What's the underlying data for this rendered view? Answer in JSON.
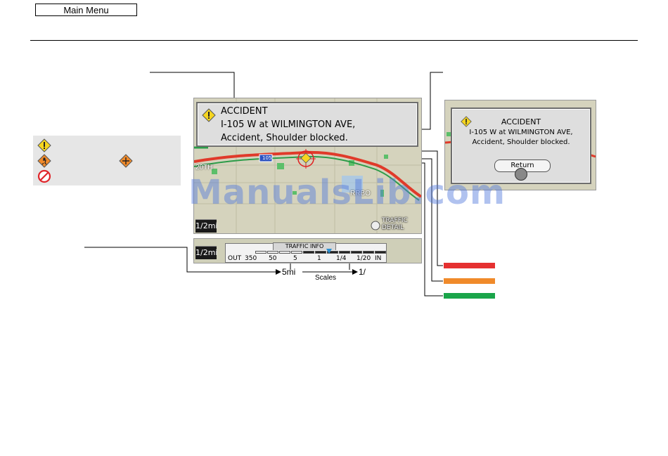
{
  "header": {
    "main_menu_label": "Main Menu"
  },
  "popup": {
    "title": "ACCIDENT",
    "line1": "I-105 W at WILMINGTON AVE,",
    "line2": "Accident, Shoulder blocked."
  },
  "popup_small": {
    "title": "ACCIDENT",
    "line1": "I-105 W at WILMINGTON AVE,",
    "line2": "Accident, Shoulder blocked.",
    "return_label": "Return"
  },
  "map": {
    "scale_badge": "1/2mi",
    "traffic_detail_line1": "TRAFFIC",
    "traffic_detail_line2": "DETAIL",
    "road_shield": "105",
    "label_20th": "20TH",
    "label_rrbo": "RRBO"
  },
  "traffic_info": {
    "scale_badge": "1/2mi",
    "tab_label": "TRAFFIC INFO",
    "out_label": "OUT",
    "ticks": [
      "350",
      "50",
      "5",
      "1",
      "1/4",
      "1/20"
    ],
    "in_label": "IN",
    "segments_on": [
      false,
      false,
      false,
      false,
      true,
      true,
      true,
      true,
      true,
      true,
      true
    ]
  },
  "scales": {
    "left_value": "5mi",
    "right_value": "1/",
    "caption": "Scales"
  },
  "colors": {
    "heavy": "#e53030",
    "moderate": "#f08a2a",
    "free": "#1aa54a",
    "incident_icon_yellow": "#f5d520",
    "construction_icon_orange": "#f08a2a",
    "closure_icon_red": "#e0262b"
  },
  "watermark": "ManualsLib.com"
}
